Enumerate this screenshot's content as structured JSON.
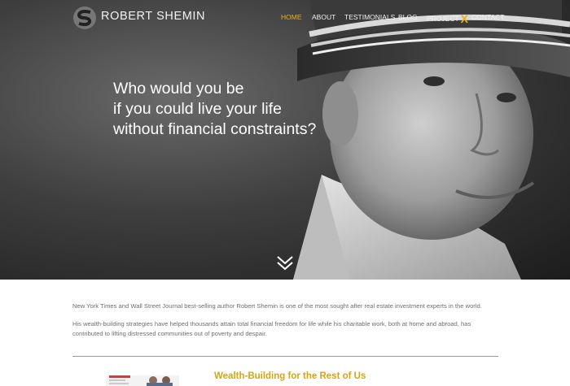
{
  "header": {
    "brand": "ROBERT SHEMIN",
    "nav": [
      {
        "label": "HOME",
        "active": true
      },
      {
        "label": "ABOUT",
        "active": false
      },
      {
        "label": "TESTIMONIALS",
        "active": false
      },
      {
        "label": "BLOG",
        "active": false
      },
      {
        "label": "PROJECT",
        "suffix": "X",
        "active": false
      },
      {
        "label": "CONTACT",
        "active": false
      }
    ]
  },
  "hero": {
    "headline_lines": [
      "Who would you be",
      "if you could live your life",
      "without financial constraints?"
    ],
    "scroll_icon": "double-chevron-down-icon"
  },
  "intro": {
    "paragraph1": "New York Times and Wall Street Journal best-selling author Robert Shemin is one of the most sought after real estate investment experts in the world.",
    "paragraph2": "His wealth-building strategies have helped thousands attain total financial freedom for life while his charitable work, both at home and abroad, has contributed to lifting distressed communities out of poverty and despair."
  },
  "section": {
    "title": "Wealth-Building for the Rest of Us"
  },
  "colors": {
    "accent": "#e9b21b",
    "section_title": "#d7a417",
    "body_text": "#6f6f6f",
    "divider": "#9a9a9a"
  }
}
